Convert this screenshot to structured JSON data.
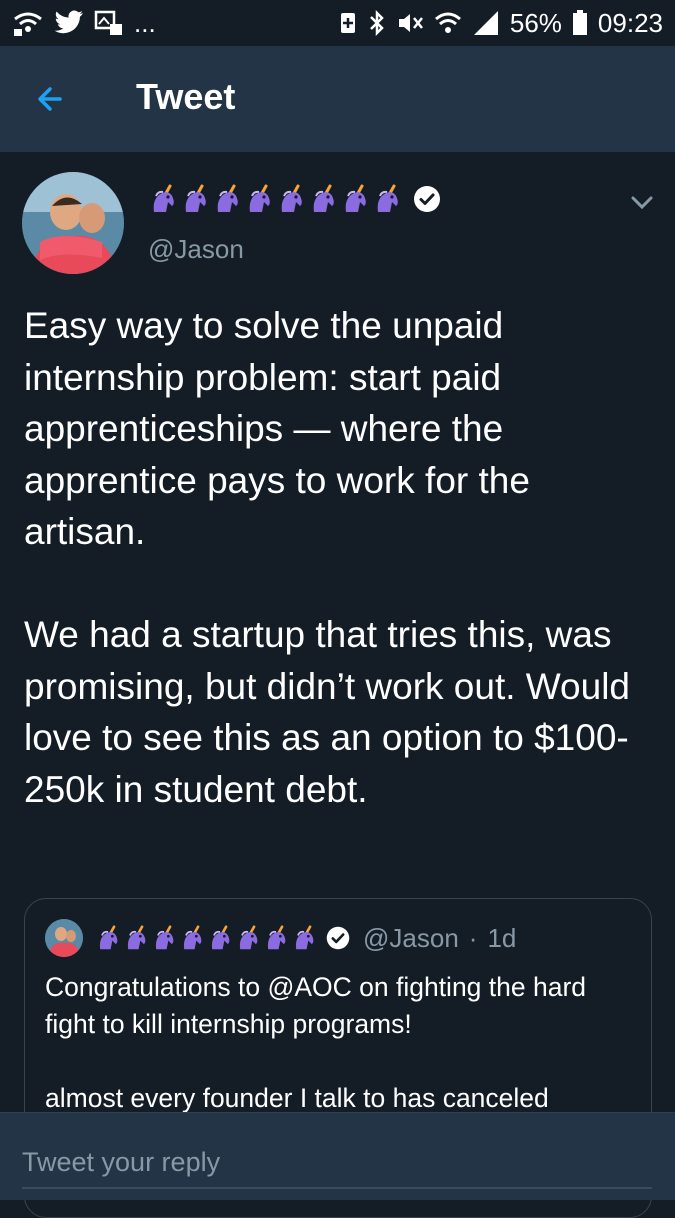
{
  "status_bar": {
    "left_ellipsis": "...",
    "battery_percent": "56%",
    "time": "09:23"
  },
  "header": {
    "title": "Tweet",
    "back_icon": "back-arrow-icon"
  },
  "tweet": {
    "author_handle": "@Jason",
    "display_name_emoji_count": 8,
    "display_name_emoji": "unicorn-icon",
    "verified": true,
    "text": "Easy way to solve the unpaid internship problem: start paid apprenticeships — where the apprentice pays to work for the artisan.\n\nWe had a startup that tries this, was promising, but didn’t work out. Would love to see this as an option to $100-250k in student debt."
  },
  "quoted_tweet": {
    "author_handle": "@Jason",
    "separator": "·",
    "time": "1d",
    "verified": true,
    "text": "Congratulations to @AOC on fighting the hard fight to kill internship programs!\n\nalmost every founder I talk to has canceled"
  },
  "reply": {
    "placeholder": "Tweet your reply"
  },
  "colors": {
    "background": "#141d26",
    "app_bar": "#243447",
    "accent": "#1da1f2",
    "secondary_text": "#8899a6",
    "unicorn": "#8a6be0"
  }
}
